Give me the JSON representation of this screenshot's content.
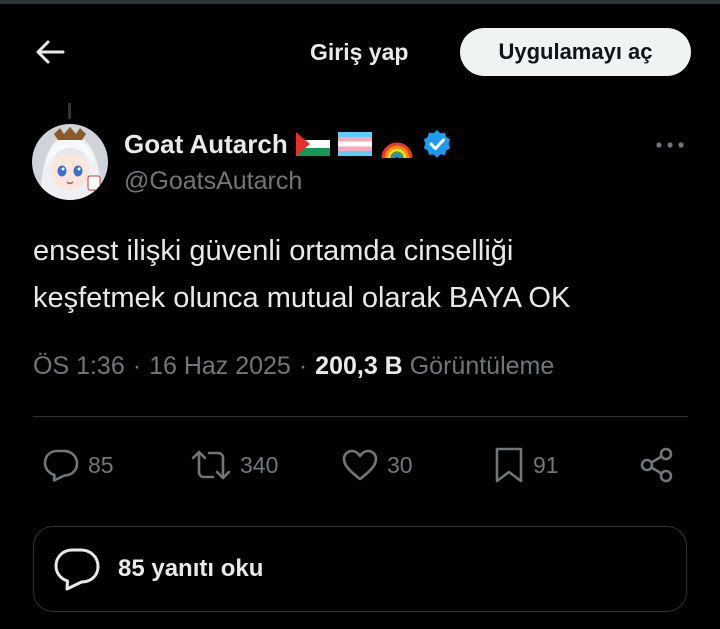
{
  "header": {
    "login_label": "Giriş yap",
    "open_app_label": "Uygulamayı aç"
  },
  "tweet": {
    "author_name": "Goat Autarch",
    "author_handle": "@GoatsAutarch",
    "name_emojis": [
      "palestine-flag",
      "transgender-flag",
      "rainbow"
    ],
    "text_line1": "ensest ilişki güvenli ortamda cinselliği",
    "text_line2": "keşfetmek olunca mutual olarak BAYA OK",
    "time": "ÖS 1:36",
    "date": "16 Haz 2025",
    "views_count": "200,3 B",
    "views_label": "Görüntüleme",
    "stats": {
      "replies": "85",
      "reposts": "340",
      "likes": "30",
      "bookmarks": "91"
    }
  },
  "replies_button": {
    "label": "85 yanıtı oku"
  },
  "colors": {
    "background": "#000000",
    "text_primary": "#e7e9ea",
    "text_secondary": "#71767b",
    "verified_blue": "#1d9bf0",
    "divider": "#2f3336",
    "button_light": "#eff3f4"
  }
}
